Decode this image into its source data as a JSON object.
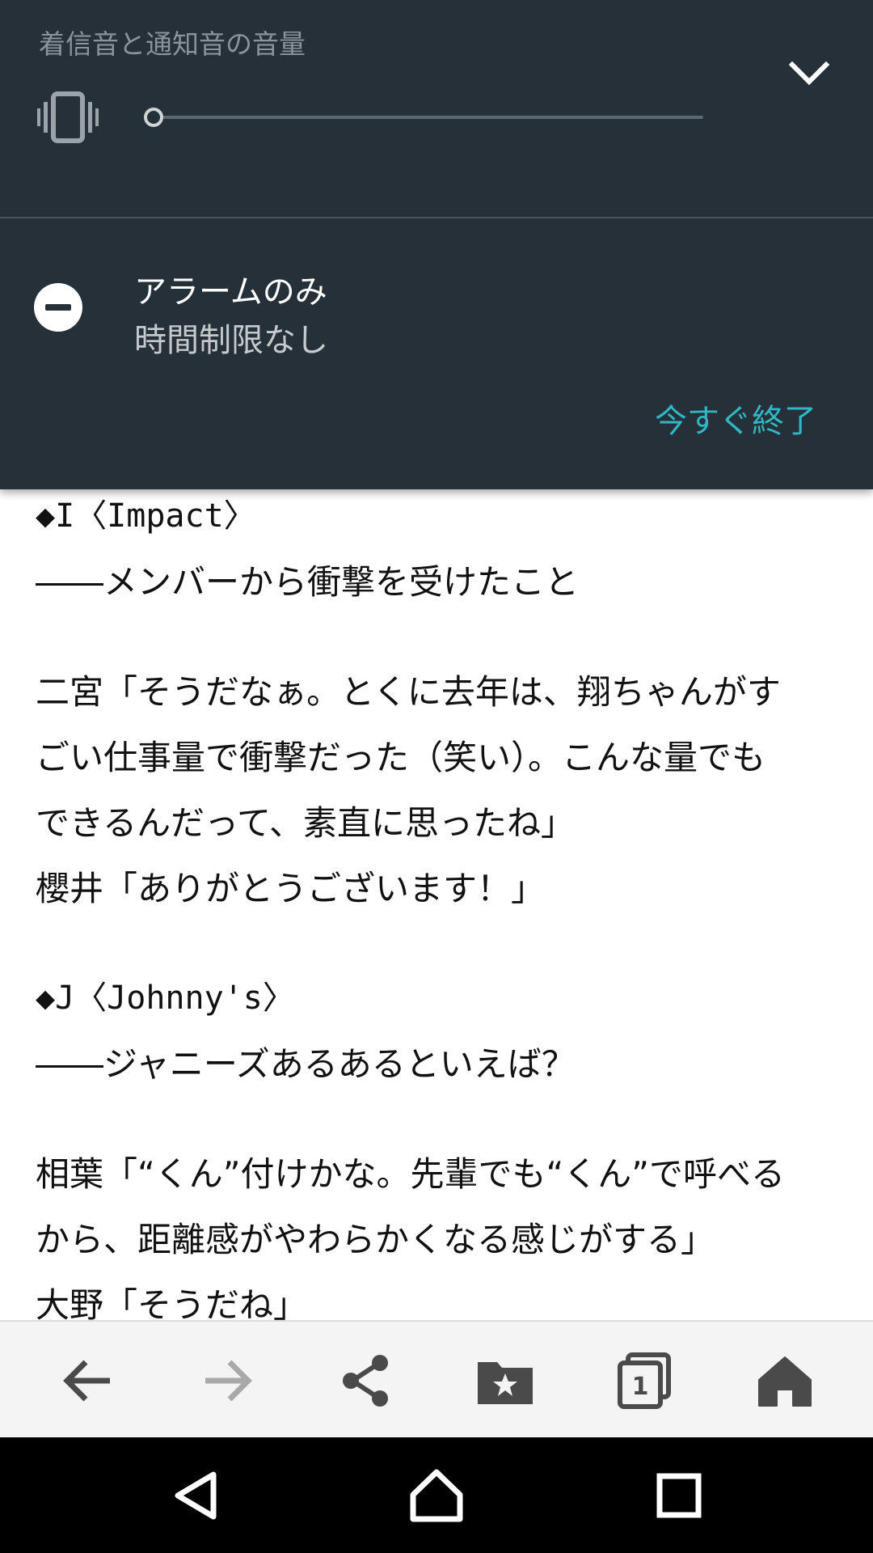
{
  "volume_panel": {
    "title": "着信音と通知音の音量",
    "level": 0,
    "mode_icon": "vibrate-icon",
    "collapse_icon": "chevron-down-icon"
  },
  "dnd": {
    "icon": "do-not-disturb-icon",
    "title": "アラームのみ",
    "subtitle": "時間制限なし",
    "end_now_label": "今すぐ終了"
  },
  "article": {
    "lines": [
      "◆I〈Impact〉",
      "――メンバーから衝撃を受けたこと",
      "二宮「そうだなぁ。とくに去年は、翔ちゃんがす",
      "ごい仕事量で衝撃だった（笑い）。こんな量でも",
      "できるんだって、素直に思ったね」",
      "櫻井「ありがとうございます！」",
      "◆J〈Johnny's〉",
      "――ジャニーズあるあるといえば？",
      "相葉「“くん”付けかな。先輩でも“くん”で呼べる",
      "から、距離感がやわらかくなる感じがする」",
      "大野「そうだね」"
    ]
  },
  "browser_toolbar": {
    "buttons": [
      "back-icon",
      "forward-icon",
      "share-icon",
      "bookmarks-icon",
      "tabs-icon",
      "home-icon"
    ],
    "tab_count": "1"
  },
  "system_nav": {
    "buttons": [
      "nav-back-icon",
      "nav-home-icon",
      "nav-recents-icon"
    ]
  },
  "colors": {
    "panel_bg": "#263038",
    "accent": "#2fb7c6"
  }
}
